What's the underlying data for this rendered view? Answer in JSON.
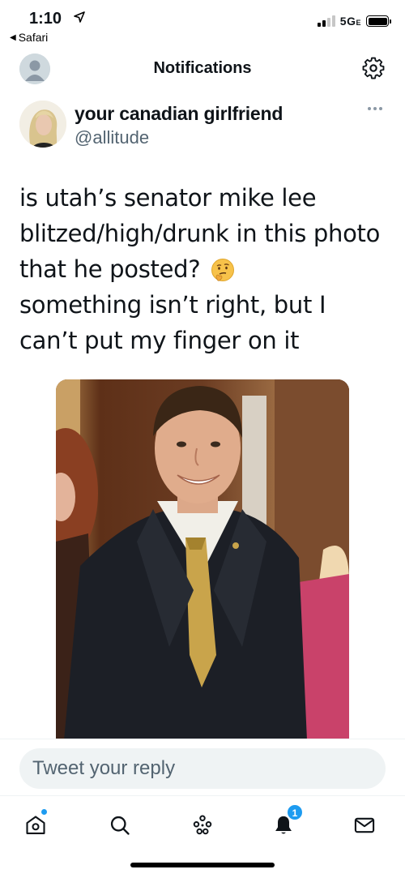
{
  "status_bar": {
    "time": "1:10",
    "back_app": "Safari",
    "network": "5G",
    "network_suffix": "E"
  },
  "header": {
    "title": "Notifications"
  },
  "tweet": {
    "author_name": "your canadian girlfriend",
    "author_handle": "@allitude",
    "text": "is utah’s senator mike lee blitzed/high/drunk in this photo that he posted?",
    "text_tail": "something isn’t right, but I can’t put my finger on it",
    "emoji": "thinking-face"
  },
  "reply": {
    "placeholder": "Tweet your reply"
  },
  "tabbar": {
    "items": [
      "home",
      "search",
      "spaces",
      "notifications",
      "messages"
    ],
    "notifications_badge": "1"
  },
  "colors": {
    "accent": "#1d9bf0",
    "text": "#0f1419",
    "secondary": "#536471"
  }
}
